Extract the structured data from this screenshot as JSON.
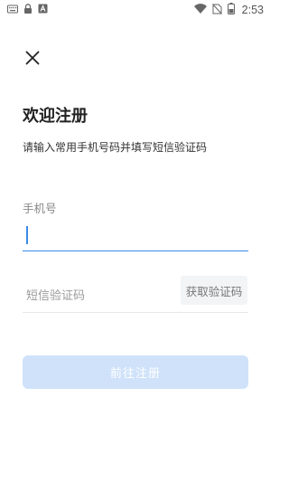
{
  "status_bar": {
    "time": "2:53",
    "icons": [
      "keyboard-icon",
      "lock-icon",
      "a-icon",
      "wifi-icon",
      "no-sim-icon",
      "battery-icon"
    ]
  },
  "header": {
    "close_icon": "close-icon"
  },
  "main": {
    "title": "欢迎注册",
    "subtitle": "请输入常用手机号码并填写短信验证码",
    "phone_label": "手机号",
    "phone_value": "",
    "code_placeholder": "短信验证码",
    "code_value": "",
    "get_code_label": "获取验证码",
    "submit_label": "前往注册"
  },
  "colors": {
    "accent": "#3b8be6",
    "submit_disabled": "#cfe2fa",
    "get_code_bg": "#f2f4f6"
  }
}
